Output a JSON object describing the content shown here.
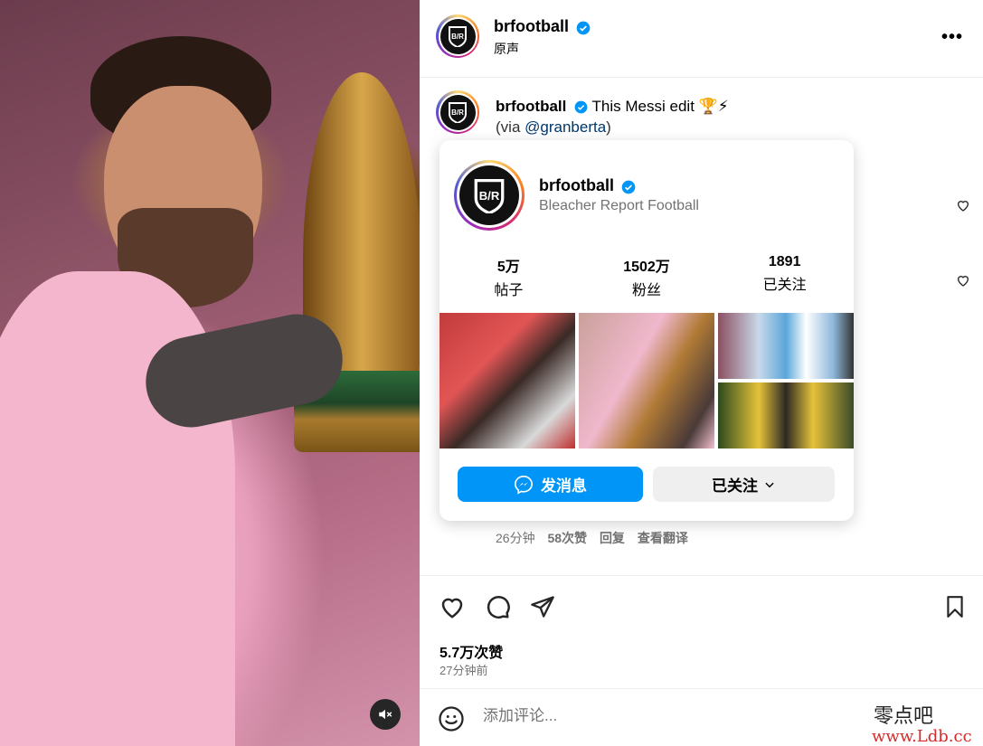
{
  "post": {
    "username": "brfootball",
    "audio": "原声",
    "more": "•••"
  },
  "caption": {
    "username": "brfootball",
    "text": "This Messi edit 🏆⚡",
    "via_prefix": "(via ",
    "mention": "@granberta",
    "via_suffix": ")"
  },
  "comment_meta": {
    "time": "26分钟",
    "likes": "58次赞",
    "reply": "回复",
    "translate": "查看翻译"
  },
  "profile_card": {
    "username": "brfootball",
    "full_name": "Bleacher Report Football",
    "stats": [
      {
        "num": "5万",
        "label": "帖子"
      },
      {
        "num": "1502万",
        "label": "粉丝"
      },
      {
        "num": "1891",
        "label": "已关注"
      }
    ],
    "message_button": "发消息",
    "following_button": "已关注"
  },
  "footer": {
    "likes": "5.7万次赞",
    "time": "27分钟前",
    "comment_placeholder": "添加评论...",
    "watermark_line1": "零点吧",
    "watermark_line2": "www.Ldb.cc"
  },
  "colors": {
    "accent_blue": "#0095f6",
    "verified_blue": "#0095f6",
    "muted_text": "#737373"
  }
}
